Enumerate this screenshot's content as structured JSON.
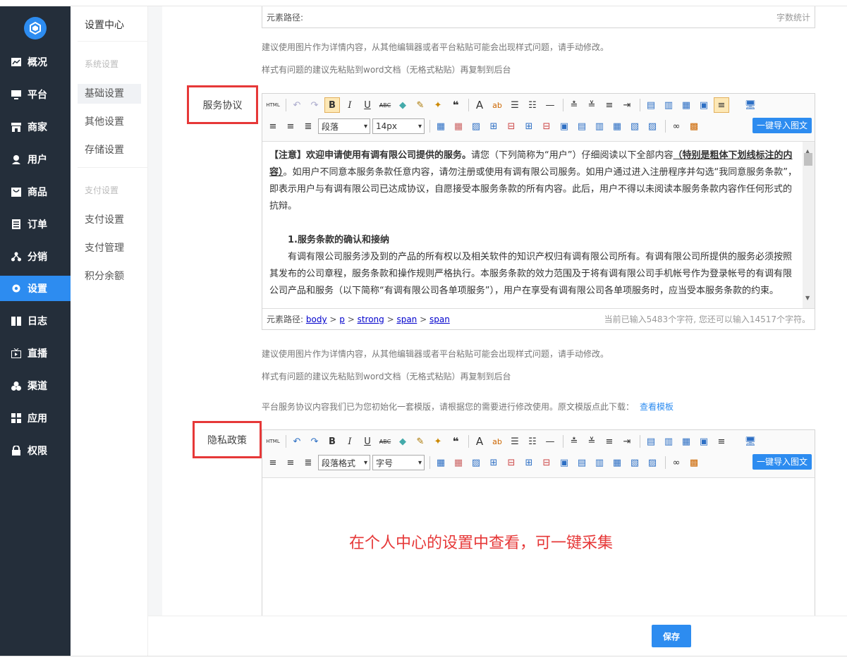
{
  "sidebar": {
    "items": [
      {
        "label": "概况",
        "icon": "chart-icon"
      },
      {
        "label": "平台",
        "icon": "monitor-icon"
      },
      {
        "label": "商家",
        "icon": "store-icon"
      },
      {
        "label": "用户",
        "icon": "user-icon"
      },
      {
        "label": "商品",
        "icon": "goods-icon"
      },
      {
        "label": "订单",
        "icon": "order-icon"
      },
      {
        "label": "分销",
        "icon": "distribution-icon"
      },
      {
        "label": "设置",
        "icon": "gear-icon"
      },
      {
        "label": "日志",
        "icon": "log-icon"
      },
      {
        "label": "直播",
        "icon": "live-icon"
      },
      {
        "label": "渠道",
        "icon": "channel-icon"
      },
      {
        "label": "应用",
        "icon": "apps-icon"
      },
      {
        "label": "权限",
        "icon": "lock-icon"
      }
    ],
    "active": "设置"
  },
  "subnav": {
    "title": "设置中心",
    "group1": "系统设置",
    "group1_items": [
      "基础设置",
      "其他设置",
      "存储设置"
    ],
    "group2": "支付设置",
    "group2_items": [
      "支付设置",
      "支付管理",
      "积分余额"
    ],
    "active": "基础设置"
  },
  "top_editor_stub": {
    "path_label": "元素路径:",
    "count_label": "字数统计"
  },
  "hints": {
    "line1": "建议使用图片作为详情内容，从其他编辑器或者平台粘贴可能会出现样式问题，请手动修改。",
    "line2": "样式有问题的建议先粘贴到word文档（无格式粘贴）再复制到后台",
    "template_note": "平台服务协议内容我们已为您初始化一套模版，请根据您的需要进行修改使用。原文模版点此下载：",
    "template_link": "查看模板"
  },
  "service_agreement": {
    "label": "服务协议",
    "paragraph_select": "段落",
    "size_select": "14px",
    "import_button": "一键导入图文",
    "content": {
      "p1_bold": "【注意】欢迎申请使用有调有限公司提供的服务。",
      "p1_a": "请您（下列简称为“用户”）仔细阅读以下全部内容",
      "p1_underline": "（特别是粗体下划线标注的内容）",
      "p1_b": "。如用户不同意本服务条款任意内容，请勿注册或使用有调有限公司服务。如用户通过进入注册程序并勾选“我同意服务条款”，即表示用户与有调有限公司已达成协议，自愿接受本服务条款的所有内容。此后，用户不得以未阅读本服务条款内容作任何形式的抗辩。",
      "heading": "1.服务条款的确认和接纳",
      "p2": "有调有限公司服务涉及到的产品的所有权以及相关软件的知识产权归有调有限公司所有。有调有限公司所提供的服务必须按照其发布的公司章程，服务条款和操作规则严格执行。本服务条款的效力范围及于将有调有限公司手机帐号作为登录帐号的有调有限公司产品和服务（以下简称“有调有限公司各单项服务”），用户在享受有调有限公司各单项服务时，应当受本服务条款的约束。"
    },
    "footer": {
      "path_label": "元素路径:",
      "path": [
        "body",
        "p",
        "strong",
        "span",
        "span"
      ],
      "count": "当前已输入5483个字符, 您还可以输入14517个字符。"
    }
  },
  "privacy_policy": {
    "label": "隐私政策",
    "paragraph_select": "段落格式",
    "size_select": "字号",
    "import_button": "一键导入图文"
  },
  "overlay_note": "在个人中心的设置中查看，可一键采集",
  "save_button": "保存"
}
